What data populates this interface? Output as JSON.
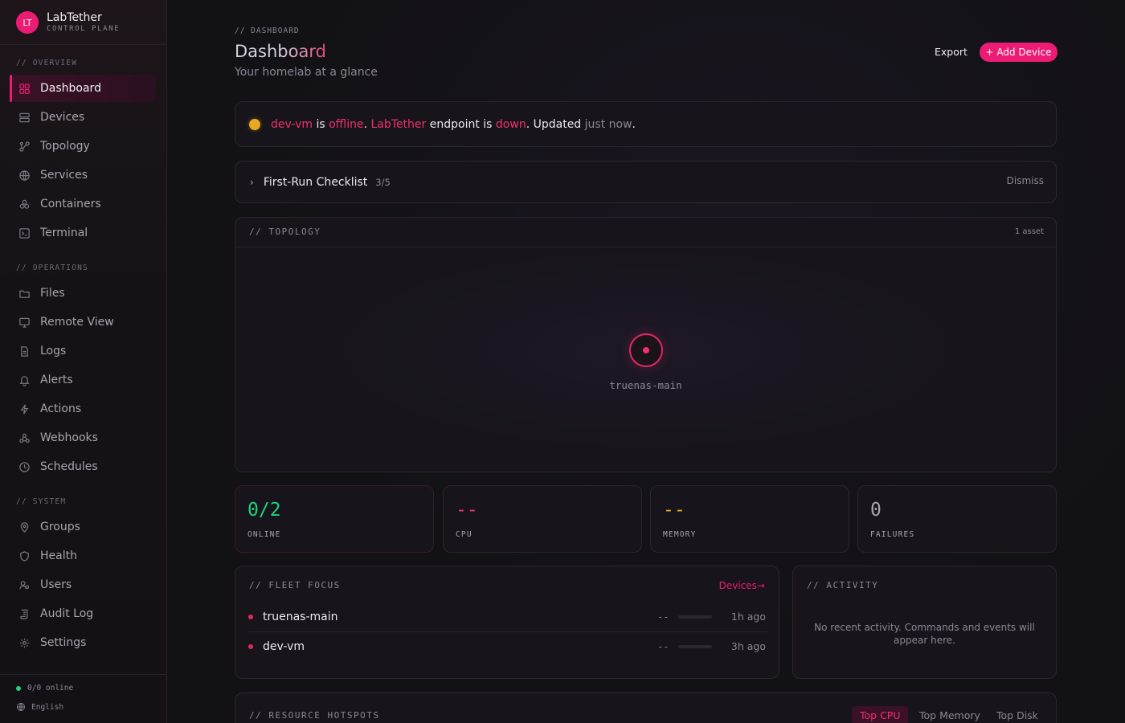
{
  "brand": {
    "initials": "LT",
    "name": "LabTether",
    "subtitle": "CONTROL PLANE"
  },
  "sidebar": {
    "sections": [
      {
        "label": "// OVERVIEW",
        "items": [
          "Dashboard",
          "Devices",
          "Topology",
          "Services",
          "Containers",
          "Terminal"
        ]
      },
      {
        "label": "// OPERATIONS",
        "items": [
          "Files",
          "Remote View",
          "Logs",
          "Alerts",
          "Actions",
          "Webhooks",
          "Schedules"
        ]
      },
      {
        "label": "// SYSTEM",
        "items": [
          "Groups",
          "Health",
          "Users",
          "Audit Log",
          "Settings"
        ]
      }
    ],
    "active_item": "Dashboard",
    "status": "0/0 online",
    "language": "English"
  },
  "header": {
    "breadcrumb": "// DASHBOARD",
    "title": "Dashboard",
    "subtitle": "Your homelab at a glance",
    "export_label": "Export",
    "add_label": "+ Add Device"
  },
  "alert": {
    "device": "dev-vm",
    "is1": " is ",
    "state1": "offline",
    "sep": ". ",
    "endpoint": "LabTether",
    "is2": " endpoint is ",
    "state2": "down",
    "updated": ". Updated ",
    "when": "just now",
    "end": "."
  },
  "checklist": {
    "title": "First-Run Checklist",
    "progress": "3/5",
    "dismiss_label": "Dismiss"
  },
  "topology": {
    "label": "// TOPOLOGY",
    "count": "1 asset",
    "node": "truenas-main"
  },
  "stats": [
    {
      "value": "0/2",
      "label": "ONLINE",
      "color": "#1ed27a"
    },
    {
      "value": "--",
      "label": "CPU",
      "color": "#f0306e"
    },
    {
      "value": "--",
      "label": "MEMORY",
      "color": "#e7a822"
    },
    {
      "value": "0",
      "label": "FAILURES",
      "color": "#a8a4b0"
    }
  ],
  "fleet": {
    "label": "// FLEET FOCUS",
    "link": "Devices→",
    "rows": [
      {
        "name": "truenas-main",
        "value": "--",
        "ago": "1h ago"
      },
      {
        "name": "dev-vm",
        "value": "--",
        "ago": "3h ago"
      }
    ]
  },
  "activity": {
    "label": "// ACTIVITY",
    "empty": "No recent activity. Commands and events will appear here."
  },
  "hotspots": {
    "label": "// RESOURCE HOTSPOTS",
    "tabs": [
      "Top CPU",
      "Top Memory",
      "Top Disk"
    ],
    "active_tab": "Top CPU"
  },
  "colors": {
    "accent": "#ec1b73",
    "success": "#1ed27a",
    "warning": "#e7a822",
    "danger": "#f0306e"
  }
}
